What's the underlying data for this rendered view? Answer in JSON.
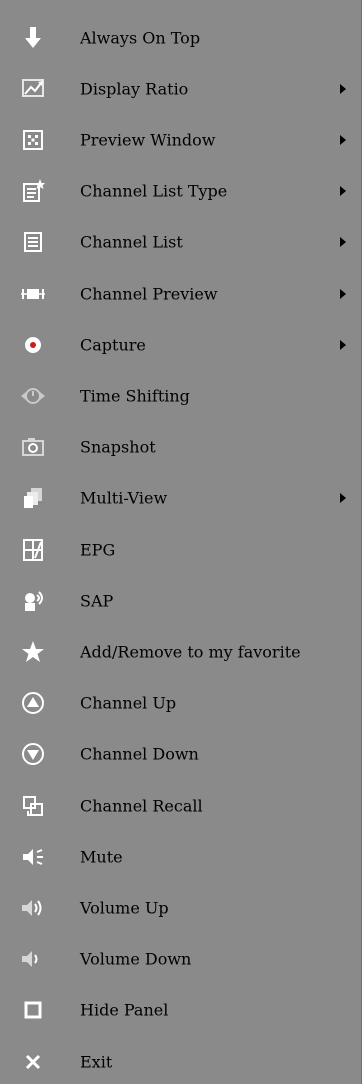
{
  "menu": {
    "items": [
      {
        "label": "Always On Top",
        "icon": "down-arrow-icon",
        "submenu": false
      },
      {
        "label": "Display Ratio",
        "icon": "display-ratio-icon",
        "submenu": true
      },
      {
        "label": "Preview Window",
        "icon": "preview-window-icon",
        "submenu": true
      },
      {
        "label": "Channel List Type",
        "icon": "channel-list-type-icon",
        "submenu": true
      },
      {
        "label": "Channel List",
        "icon": "channel-list-icon",
        "submenu": true
      },
      {
        "label": "Channel Preview",
        "icon": "channel-preview-icon",
        "submenu": true
      },
      {
        "label": "Capture",
        "icon": "capture-icon",
        "submenu": true
      },
      {
        "label": "Time Shifting",
        "icon": "time-shifting-icon",
        "submenu": false
      },
      {
        "label": "Snapshot",
        "icon": "snapshot-icon",
        "submenu": false
      },
      {
        "label": "Multi-View",
        "icon": "multi-view-icon",
        "submenu": true
      },
      {
        "label": "EPG",
        "icon": "epg-icon",
        "submenu": false
      },
      {
        "label": "SAP",
        "icon": "sap-icon",
        "submenu": false
      },
      {
        "label": "Add/Remove to my favorite",
        "icon": "favorite-star-icon",
        "submenu": false
      },
      {
        "label": "Channel Up",
        "icon": "channel-up-icon",
        "submenu": false
      },
      {
        "label": "Channel Down",
        "icon": "channel-down-icon",
        "submenu": false
      },
      {
        "label": "Channel Recall",
        "icon": "channel-recall-icon",
        "submenu": false
      },
      {
        "label": "Mute",
        "icon": "mute-icon",
        "submenu": false
      },
      {
        "label": "Volume Up",
        "icon": "volume-up-icon",
        "submenu": false
      },
      {
        "label": "Volume Down",
        "icon": "volume-down-icon",
        "submenu": false
      },
      {
        "label": "Hide Panel",
        "icon": "hide-panel-icon",
        "submenu": false
      },
      {
        "label": "Exit",
        "icon": "exit-icon",
        "submenu": false
      }
    ]
  },
  "colors": {
    "background": "#8a8a8a",
    "text": "#000000",
    "icon_white": "#ffffff",
    "icon_light": "#d6d6d6",
    "capture_dot": "#cc1b1b"
  }
}
